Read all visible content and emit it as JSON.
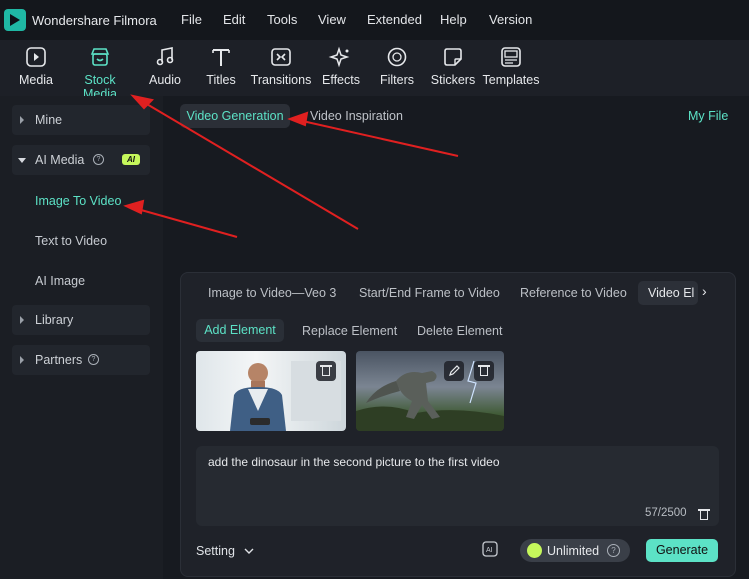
{
  "app": {
    "title": "Wondershare Filmora"
  },
  "menu": [
    "File",
    "Edit",
    "Tools",
    "View",
    "Extended",
    "Help",
    "Version"
  ],
  "toolbar": {
    "items": [
      {
        "label": "Media",
        "icon": "media-icon"
      },
      {
        "label": "Stock Media",
        "icon": "store-icon",
        "active": true
      },
      {
        "label": "Audio",
        "icon": "music-note-icon"
      },
      {
        "label": "Titles",
        "icon": "text-icon"
      },
      {
        "label": "Transitions",
        "icon": "transition-icon"
      },
      {
        "label": "Effects",
        "icon": "sparkle-icon"
      },
      {
        "label": "Filters",
        "icon": "filter-icon"
      },
      {
        "label": "Stickers",
        "icon": "sticker-icon"
      },
      {
        "label": "Templates",
        "icon": "template-icon"
      }
    ]
  },
  "sidebar": {
    "mine": "Mine",
    "ai_media": "AI Media",
    "ai_badge": "AI",
    "image_to_video": "Image To Video",
    "text_to_video": "Text to Video",
    "ai_image": "AI Image",
    "library": "Library",
    "partners": "Partners"
  },
  "main": {
    "tab_video_generation": "Video Generation",
    "tab_video_inspiration": "Video Inspiration",
    "my_file": "My File"
  },
  "panel": {
    "tabs": [
      "Image to Video—Veo 3",
      "Start/End Frame to Video",
      "Reference to Video"
    ],
    "active_tab": "Video El",
    "element_tabs": [
      "Add Element",
      "Replace Element",
      "Delete Element"
    ],
    "prompt": "add the dinosaur in the second picture to the first video",
    "counter": "57/2500",
    "setting": "Setting",
    "unlimited": "Unlimited",
    "generate": "Generate"
  },
  "colors": {
    "accent": "#5ce2c6",
    "annotation_arrow": "#e02020",
    "ai_badge": "#c5f75b"
  }
}
